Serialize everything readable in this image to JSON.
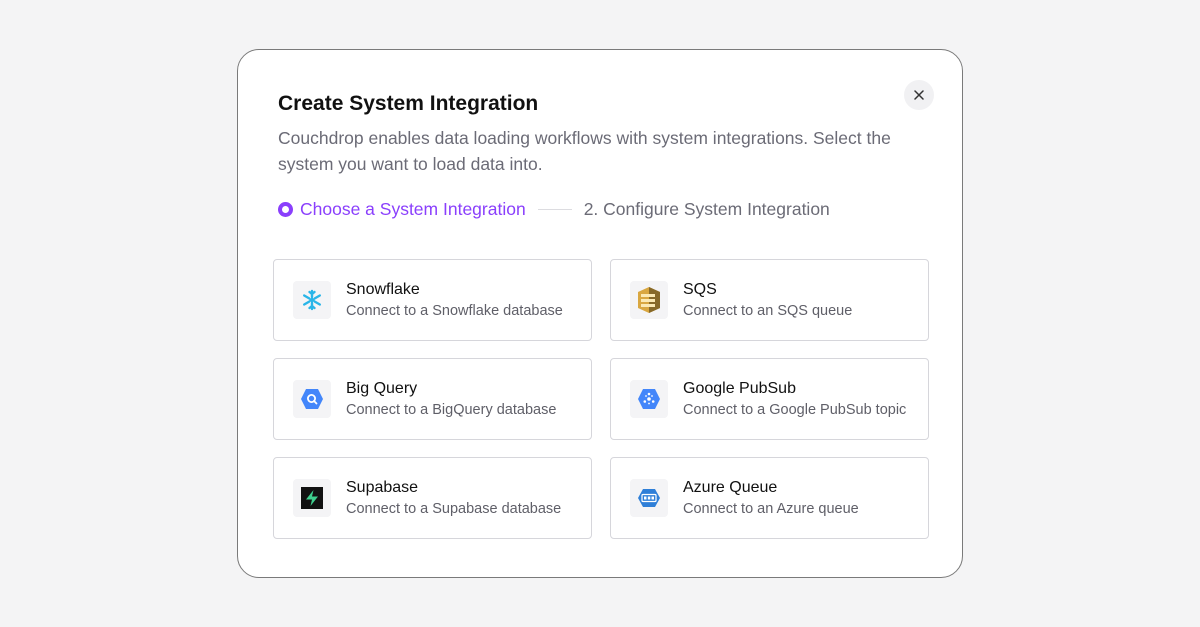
{
  "modal": {
    "title": "Create System Integration",
    "description": "Couchdrop enables data loading workflows with system integrations. Select the system you want to load data into.",
    "close_label": "×"
  },
  "steps": {
    "active_label": "Choose a System Integration",
    "next_label": "2. Configure System Integration"
  },
  "colors": {
    "accent": "#8a3ffc"
  },
  "integrations": [
    {
      "icon": "snowflake-icon",
      "title": "Snowflake",
      "subtitle": "Connect to a Snowflake database"
    },
    {
      "icon": "sqs-icon",
      "title": "SQS",
      "subtitle": "Connect to an SQS queue"
    },
    {
      "icon": "bigquery-icon",
      "title": "Big Query",
      "subtitle": "Connect to a BigQuery database"
    },
    {
      "icon": "pubsub-icon",
      "title": "Google PubSub",
      "subtitle": "Connect to a Google PubSub topic"
    },
    {
      "icon": "supabase-icon",
      "title": "Supabase",
      "subtitle": "Connect to a Supabase database"
    },
    {
      "icon": "azure-queue-icon",
      "title": "Azure Queue",
      "subtitle": "Connect to an Azure queue"
    }
  ]
}
